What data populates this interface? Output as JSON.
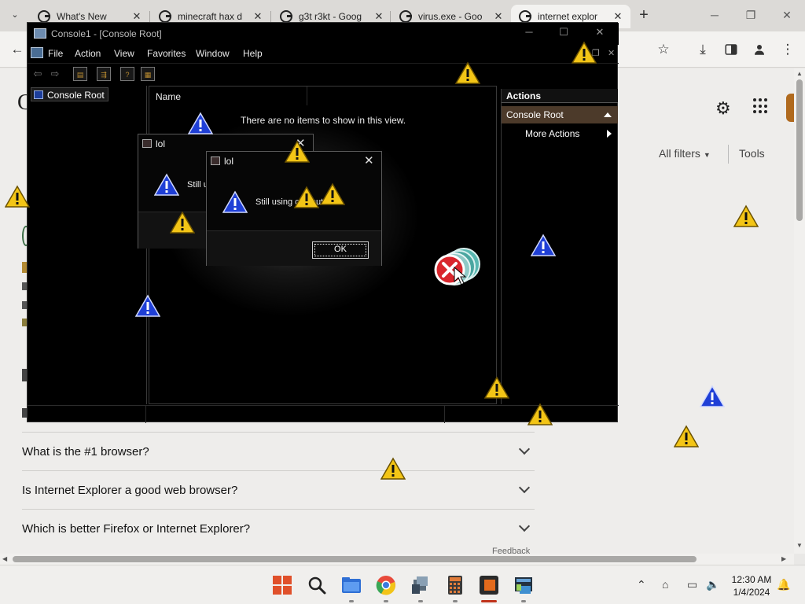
{
  "browser": {
    "tabs": [
      {
        "title": "What's New",
        "active": false
      },
      {
        "title": "minecraft hax d",
        "active": false
      },
      {
        "title": "g3t r3kt - Goog",
        "active": false
      },
      {
        "title": "virus.exe - Goo",
        "active": false
      },
      {
        "title": "internet explor",
        "active": true
      }
    ],
    "new_tab": "+",
    "window_controls": {
      "minimize": "─",
      "restore": "❐",
      "close": "✕"
    }
  },
  "google": {
    "filters_label": "All filters",
    "tools_label": "Tools",
    "faqs": [
      "What is the #1 browser?",
      "Is Internet Explorer a good web browser?",
      "Which is better Firefox or Internet Explorer?"
    ],
    "feedback": "Feedback"
  },
  "mmc": {
    "title": "Console1 - [Console Root]",
    "menu": [
      "File",
      "Action",
      "View",
      "Favorites",
      "Window",
      "Help"
    ],
    "tree_root": "Console Root",
    "list_column": "Name",
    "empty_text": "There are no items to show in this view.",
    "actions_header": "Actions",
    "actions_selected": "Console Root",
    "more_actions": "More Actions"
  },
  "dialogs": [
    {
      "title": "lol",
      "message": "Still u",
      "back": true
    },
    {
      "title": "lol",
      "message": "Still using computer?",
      "ok_label": "OK",
      "back": false
    }
  ],
  "taskbar": {
    "time": "12:30 AM",
    "date": "1/4/2024"
  },
  "colors": {
    "warning_yellow": "#f3c516",
    "info_blue": "#1f3fd6",
    "error_red": "#d9262c",
    "accent_orange": "#b06a1e"
  }
}
